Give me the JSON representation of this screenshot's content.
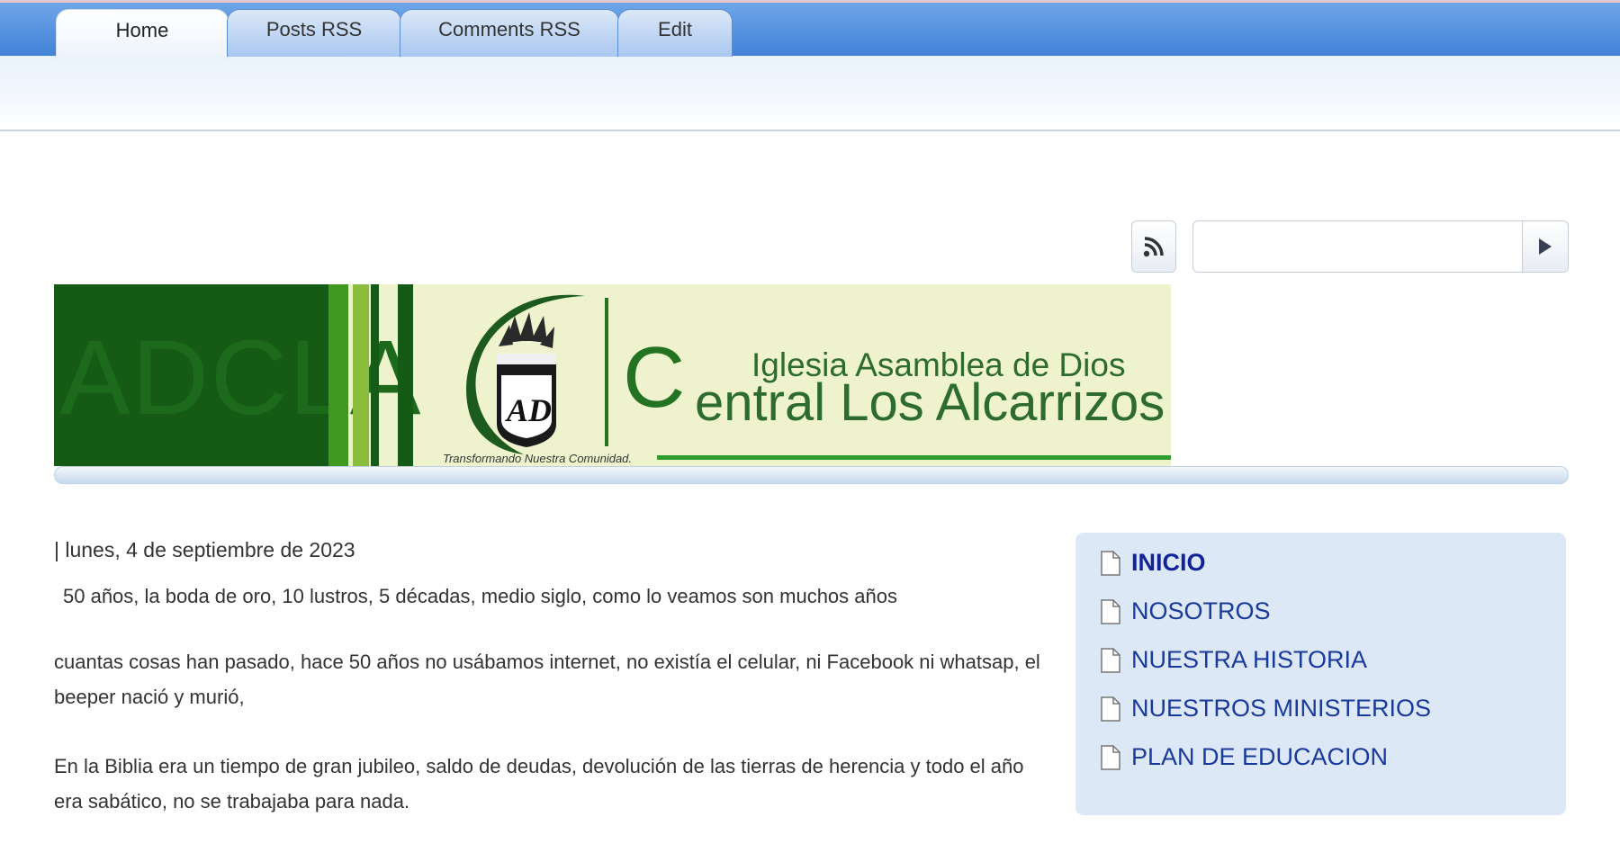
{
  "nav": {
    "tabs": [
      {
        "label": "Home",
        "active": true
      },
      {
        "label": "Posts RSS"
      },
      {
        "label": "Comments RSS"
      },
      {
        "label": "Edit"
      }
    ]
  },
  "search": {
    "value": "",
    "rss_icon": "rss-icon",
    "submit_icon": "play-arrow-icon"
  },
  "banner": {
    "watermark": "ADCLA",
    "church_line1": "Iglesia Asamblea de Dios",
    "church_line2_initial": "C",
    "church_line2_rest": "entral Los Alcarrizos",
    "tagline": "Transformando Nuestra Comunidad.",
    "colors": {
      "dark_green": "#155b15",
      "green": "#2e9b2e",
      "pale": "#eef3cd"
    }
  },
  "post": {
    "date": "| lunes, 4 de septiembre de 2023",
    "lead": "50 años, la boda de oro, 10 lustros, 5 décadas, medio siglo, como lo veamos son muchos años",
    "paragraphs": [
      "cuantas cosas han pasado, hace 50 años no usábamos internet, no existía el celular, ni Facebook ni whatsap, el beeper nació y murió,",
      "En la Biblia era un tiempo de gran jubileo, saldo de deudas, devolución de las tierras de herencia y todo el año era sabático, no se trabajaba para nada."
    ]
  },
  "sidebar": {
    "items": [
      {
        "label": "INICIO",
        "active": true
      },
      {
        "label": "NOSOTROS"
      },
      {
        "label": "NUESTRA HISTORIA"
      },
      {
        "label": "NUESTROS MINISTERIOS"
      },
      {
        "label": "PLAN DE EDUCACION"
      }
    ]
  }
}
